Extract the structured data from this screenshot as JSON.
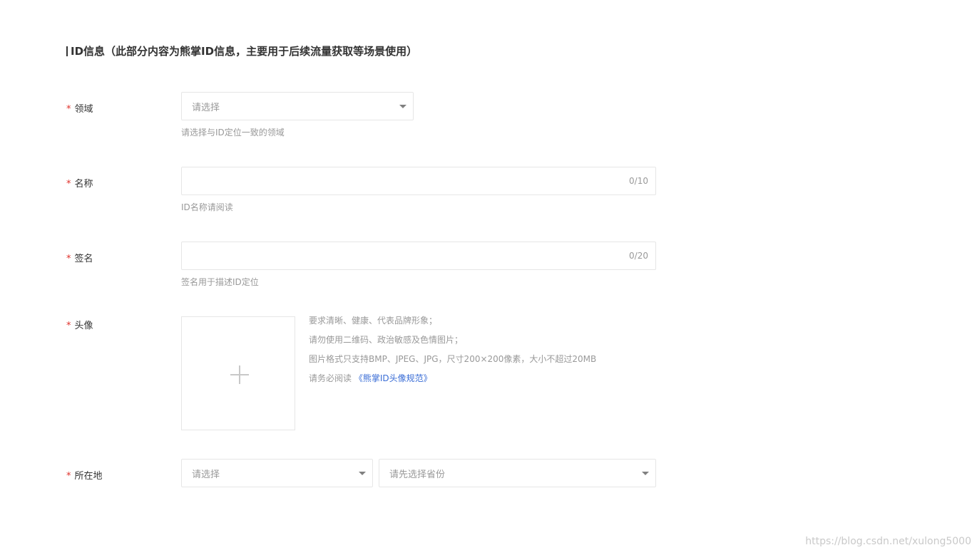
{
  "section": {
    "title": "ID信息（此部分内容为熊掌ID信息，主要用于后续流量获取等场景使用）"
  },
  "required_mark": "*",
  "domain_field": {
    "label": "领域",
    "placeholder": "请选择",
    "hint": "请选择与ID定位一致的领域"
  },
  "name_field": {
    "label": "名称",
    "counter": "0/10",
    "hint": "ID名称请阅读"
  },
  "signature_field": {
    "label": "签名",
    "counter": "0/20",
    "hint": "签名用于描述ID定位"
  },
  "avatar_field": {
    "label": "头像",
    "notes": [
      "要求清晰、健康、代表品牌形象；",
      "请勿使用二维码、政治敏感及色情图片；",
      "图片格式只支持BMP、JPEG、JPG，尺寸200×200像素，大小不超过20MB"
    ],
    "read_prefix": "请务必阅读",
    "read_link": "《熊掌ID头像规范》"
  },
  "location_field": {
    "label": "所在地",
    "province_placeholder": "请选择",
    "city_placeholder": "请先选择省份"
  },
  "watermark": "https://blog.csdn.net/xulong5000",
  "colors": {
    "required": "#e0312b",
    "link": "#3a6dd6",
    "border": "#e6e6e6",
    "hint": "#999999"
  }
}
